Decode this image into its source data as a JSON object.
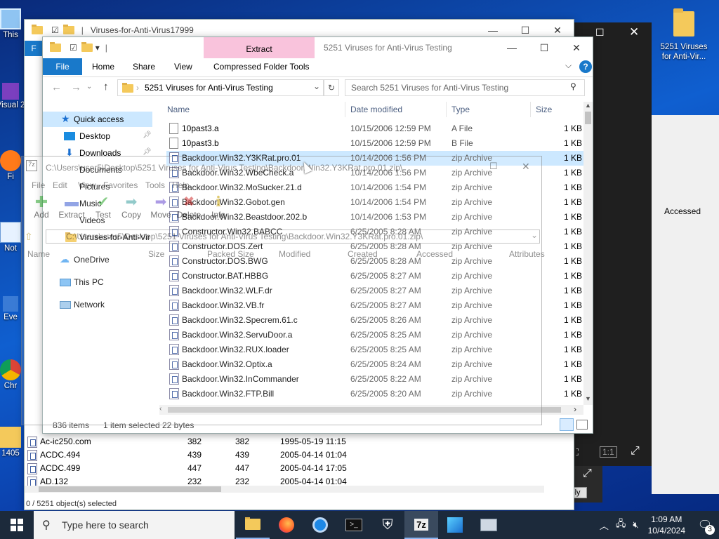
{
  "desktop": {
    "icons": [
      {
        "label": "This"
      },
      {
        "label": "Visual 2"
      },
      {
        "label": "Fi"
      },
      {
        "label": "Not"
      },
      {
        "label": "Eve"
      },
      {
        "label": "Chr"
      },
      {
        "label": "1405"
      },
      {
        "label": "5251 Viruses for Anti-Vir..."
      }
    ]
  },
  "back_explorer": {
    "title": "Viruses-for-Anti-Virus17999"
  },
  "main_explorer": {
    "title": "5251 Viruses for Anti-Virus Testing",
    "context_tab": "Extract",
    "tabs": [
      "File",
      "Home",
      "Share",
      "View",
      "Compressed Folder Tools"
    ],
    "address": "5251 Viruses for Anti-Virus Testing",
    "search_placeholder": "Search 5251 Viruses for Anti-Virus Testing",
    "columns": {
      "name": "Name",
      "date": "Date modified",
      "type": "Type",
      "size": "Size"
    },
    "nav": [
      {
        "label": "Quick access",
        "icon": "star-icon"
      },
      {
        "label": "Desktop",
        "icon": "desktop-icon"
      },
      {
        "label": "Downloads",
        "icon": "download-icon"
      },
      {
        "label": "Documents",
        "icon": "documents-icon"
      },
      {
        "label": "Pictures",
        "icon": "pictures-icon"
      },
      {
        "label": "Music",
        "icon": "music-icon"
      },
      {
        "label": "Videos",
        "icon": "videos-icon"
      },
      {
        "label": "Viruses-for-Anti-Vir",
        "icon": "folder-icon"
      },
      {
        "label": "OneDrive",
        "icon": "cloud-icon"
      },
      {
        "label": "This PC",
        "icon": "pc-icon"
      },
      {
        "label": "Network",
        "icon": "network-icon"
      }
    ],
    "files": [
      {
        "name": "10past3.a",
        "date": "10/15/2006 12:59 PM",
        "type": "A File",
        "size": "1 KB",
        "icon": "file"
      },
      {
        "name": "10past3.b",
        "date": "10/15/2006 12:59 PM",
        "type": "B File",
        "size": "1 KB",
        "icon": "file"
      },
      {
        "name": "Backdoor.Win32.Y3KRat.pro.01",
        "date": "10/14/2006 1:56 PM",
        "type": "zip Archive",
        "size": "1 KB",
        "icon": "zip"
      },
      {
        "name": "Backdoor.Win32.WbeCheck.a",
        "date": "10/14/2006 1:56 PM",
        "type": "zip Archive",
        "size": "1 KB",
        "icon": "zip"
      },
      {
        "name": "Backdoor.Win32.MoSucker.21.d",
        "date": "10/14/2006 1:54 PM",
        "type": "zip Archive",
        "size": "1 KB",
        "icon": "zip"
      },
      {
        "name": "Backdoor.Win32.Gobot.gen",
        "date": "10/14/2006 1:54 PM",
        "type": "zip Archive",
        "size": "1 KB",
        "icon": "zip"
      },
      {
        "name": "Backdoor.Win32.Beastdoor.202.b",
        "date": "10/14/2006 1:53 PM",
        "type": "zip Archive",
        "size": "1 KB",
        "icon": "zip"
      },
      {
        "name": "Constructor.Win32.BABCC",
        "date": "6/25/2005 8:28 AM",
        "type": "zip Archive",
        "size": "1 KB",
        "icon": "zip"
      },
      {
        "name": "Constructor.DOS.Zert",
        "date": "6/25/2005 8:28 AM",
        "type": "zip Archive",
        "size": "1 KB",
        "icon": "zip"
      },
      {
        "name": "Constructor.DOS.BWG",
        "date": "6/25/2005 8:28 AM",
        "type": "zip Archive",
        "size": "1 KB",
        "icon": "zip"
      },
      {
        "name": "Constructor.BAT.HBBG",
        "date": "6/25/2005 8:27 AM",
        "type": "zip Archive",
        "size": "1 KB",
        "icon": "zip"
      },
      {
        "name": "Backdoor.Win32.WLF.dr",
        "date": "6/25/2005 8:27 AM",
        "type": "zip Archive",
        "size": "1 KB",
        "icon": "zip"
      },
      {
        "name": "Backdoor.Win32.VB.fr",
        "date": "6/25/2005 8:27 AM",
        "type": "zip Archive",
        "size": "1 KB",
        "icon": "zip"
      },
      {
        "name": "Backdoor.Win32.Specrem.61.c",
        "date": "6/25/2005 8:26 AM",
        "type": "zip Archive",
        "size": "1 KB",
        "icon": "zip"
      },
      {
        "name": "Backdoor.Win32.ServuDoor.a",
        "date": "6/25/2005 8:25 AM",
        "type": "zip Archive",
        "size": "1 KB",
        "icon": "zip"
      },
      {
        "name": "Backdoor.Win32.RUX.loader",
        "date": "6/25/2005 8:25 AM",
        "type": "zip Archive",
        "size": "1 KB",
        "icon": "zip"
      },
      {
        "name": "Backdoor.Win32.Optix.a",
        "date": "6/25/2005 8:24 AM",
        "type": "zip Archive",
        "size": "1 KB",
        "icon": "zip"
      },
      {
        "name": "Backdoor.Win32.InCommander",
        "date": "6/25/2005 8:22 AM",
        "type": "zip Archive",
        "size": "1 KB",
        "icon": "zip"
      },
      {
        "name": "Backdoor.Win32.FTP.Bill",
        "date": "6/25/2005 8:20 AM",
        "type": "zip Archive",
        "size": "1 KB",
        "icon": "zip"
      }
    ],
    "status": {
      "count": "836 items",
      "selected": "1 item selected",
      "size": "22 bytes"
    }
  },
  "sevenzip": {
    "title": "C:\\Users\\user5\\Desktop\\5251 Viruses for Anti-Virus Testing\\Backdoor.Win32.Y3KRat.pro.01.zip\\",
    "menu": [
      "File",
      "Edit",
      "View",
      "Favorites",
      "Tools",
      "Help"
    ],
    "toolbar": [
      "Add",
      "Extract",
      "Test",
      "Copy",
      "Move",
      "Delete",
      "Info"
    ],
    "path": "C:\\Users\\user5\\Desktop\\5251 Viruses for Anti-Virus Testing\\Backdoor.Win32.Y3KRat.pro.01.zip\\",
    "columns": [
      "Name",
      "Size",
      "Packed Size",
      "Modified",
      "Created",
      "Accessed",
      "Attributes"
    ]
  },
  "back_list": {
    "rows": [
      {
        "name": "Ac-ic250.com",
        "size": "382",
        "packed": "382",
        "date": "1995-05-19 11:15"
      },
      {
        "name": "ACDC.494",
        "size": "439",
        "packed": "439",
        "date": "2005-04-14 01:04"
      },
      {
        "name": "ACDC.499",
        "size": "447",
        "packed": "447",
        "date": "2005-04-14 17:05"
      },
      {
        "name": "AD.132",
        "size": "232",
        "packed": "232",
        "date": "2005-04-14 01:04"
      }
    ],
    "status": "0 / 5251 object(s) selected",
    "accessed_header": "Accessed",
    "apply": "Apply"
  },
  "taskbar": {
    "search_placeholder": "Type here to search",
    "time": "1:09 AM",
    "date": "10/4/2024",
    "notifications": "3",
    "zip_label": "7z"
  }
}
